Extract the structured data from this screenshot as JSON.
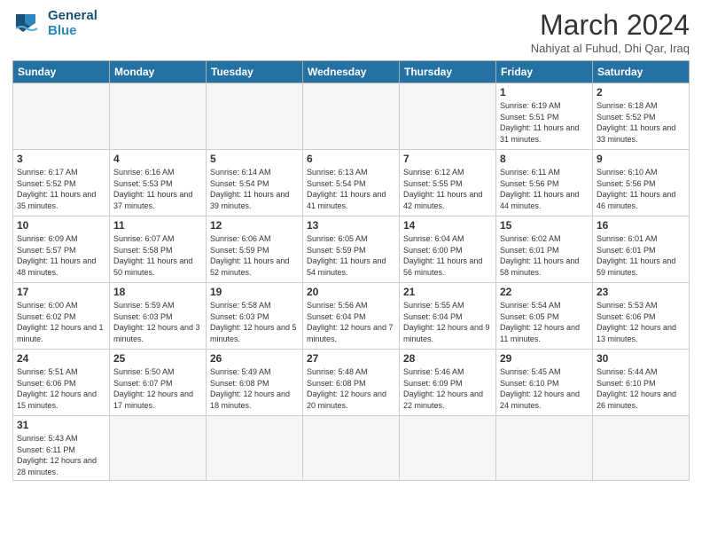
{
  "header": {
    "logo_general": "General",
    "logo_blue": "Blue",
    "month_title": "March 2024",
    "subtitle": "Nahiyat al Fuhud, Dhi Qar, Iraq"
  },
  "weekdays": [
    "Sunday",
    "Monday",
    "Tuesday",
    "Wednesday",
    "Thursday",
    "Friday",
    "Saturday"
  ],
  "weeks": [
    [
      {
        "day": "",
        "info": ""
      },
      {
        "day": "",
        "info": ""
      },
      {
        "day": "",
        "info": ""
      },
      {
        "day": "",
        "info": ""
      },
      {
        "day": "",
        "info": ""
      },
      {
        "day": "1",
        "info": "Sunrise: 6:19 AM\nSunset: 5:51 PM\nDaylight: 11 hours\nand 31 minutes."
      },
      {
        "day": "2",
        "info": "Sunrise: 6:18 AM\nSunset: 5:52 PM\nDaylight: 11 hours\nand 33 minutes."
      }
    ],
    [
      {
        "day": "3",
        "info": "Sunrise: 6:17 AM\nSunset: 5:52 PM\nDaylight: 11 hours\nand 35 minutes."
      },
      {
        "day": "4",
        "info": "Sunrise: 6:16 AM\nSunset: 5:53 PM\nDaylight: 11 hours\nand 37 minutes."
      },
      {
        "day": "5",
        "info": "Sunrise: 6:14 AM\nSunset: 5:54 PM\nDaylight: 11 hours\nand 39 minutes."
      },
      {
        "day": "6",
        "info": "Sunrise: 6:13 AM\nSunset: 5:54 PM\nDaylight: 11 hours\nand 41 minutes."
      },
      {
        "day": "7",
        "info": "Sunrise: 6:12 AM\nSunset: 5:55 PM\nDaylight: 11 hours\nand 42 minutes."
      },
      {
        "day": "8",
        "info": "Sunrise: 6:11 AM\nSunset: 5:56 PM\nDaylight: 11 hours\nand 44 minutes."
      },
      {
        "day": "9",
        "info": "Sunrise: 6:10 AM\nSunset: 5:56 PM\nDaylight: 11 hours\nand 46 minutes."
      }
    ],
    [
      {
        "day": "10",
        "info": "Sunrise: 6:09 AM\nSunset: 5:57 PM\nDaylight: 11 hours\nand 48 minutes."
      },
      {
        "day": "11",
        "info": "Sunrise: 6:07 AM\nSunset: 5:58 PM\nDaylight: 11 hours\nand 50 minutes."
      },
      {
        "day": "12",
        "info": "Sunrise: 6:06 AM\nSunset: 5:59 PM\nDaylight: 11 hours\nand 52 minutes."
      },
      {
        "day": "13",
        "info": "Sunrise: 6:05 AM\nSunset: 5:59 PM\nDaylight: 11 hours\nand 54 minutes."
      },
      {
        "day": "14",
        "info": "Sunrise: 6:04 AM\nSunset: 6:00 PM\nDaylight: 11 hours\nand 56 minutes."
      },
      {
        "day": "15",
        "info": "Sunrise: 6:02 AM\nSunset: 6:01 PM\nDaylight: 11 hours\nand 58 minutes."
      },
      {
        "day": "16",
        "info": "Sunrise: 6:01 AM\nSunset: 6:01 PM\nDaylight: 11 hours\nand 59 minutes."
      }
    ],
    [
      {
        "day": "17",
        "info": "Sunrise: 6:00 AM\nSunset: 6:02 PM\nDaylight: 12 hours\nand 1 minute."
      },
      {
        "day": "18",
        "info": "Sunrise: 5:59 AM\nSunset: 6:03 PM\nDaylight: 12 hours\nand 3 minutes."
      },
      {
        "day": "19",
        "info": "Sunrise: 5:58 AM\nSunset: 6:03 PM\nDaylight: 12 hours\nand 5 minutes."
      },
      {
        "day": "20",
        "info": "Sunrise: 5:56 AM\nSunset: 6:04 PM\nDaylight: 12 hours\nand 7 minutes."
      },
      {
        "day": "21",
        "info": "Sunrise: 5:55 AM\nSunset: 6:04 PM\nDaylight: 12 hours\nand 9 minutes."
      },
      {
        "day": "22",
        "info": "Sunrise: 5:54 AM\nSunset: 6:05 PM\nDaylight: 12 hours\nand 11 minutes."
      },
      {
        "day": "23",
        "info": "Sunrise: 5:53 AM\nSunset: 6:06 PM\nDaylight: 12 hours\nand 13 minutes."
      }
    ],
    [
      {
        "day": "24",
        "info": "Sunrise: 5:51 AM\nSunset: 6:06 PM\nDaylight: 12 hours\nand 15 minutes."
      },
      {
        "day": "25",
        "info": "Sunrise: 5:50 AM\nSunset: 6:07 PM\nDaylight: 12 hours\nand 17 minutes."
      },
      {
        "day": "26",
        "info": "Sunrise: 5:49 AM\nSunset: 6:08 PM\nDaylight: 12 hours\nand 18 minutes."
      },
      {
        "day": "27",
        "info": "Sunrise: 5:48 AM\nSunset: 6:08 PM\nDaylight: 12 hours\nand 20 minutes."
      },
      {
        "day": "28",
        "info": "Sunrise: 5:46 AM\nSunset: 6:09 PM\nDaylight: 12 hours\nand 22 minutes."
      },
      {
        "day": "29",
        "info": "Sunrise: 5:45 AM\nSunset: 6:10 PM\nDaylight: 12 hours\nand 24 minutes."
      },
      {
        "day": "30",
        "info": "Sunrise: 5:44 AM\nSunset: 6:10 PM\nDaylight: 12 hours\nand 26 minutes."
      }
    ],
    [
      {
        "day": "31",
        "info": "Sunrise: 5:43 AM\nSunset: 6:11 PM\nDaylight: 12 hours\nand 28 minutes."
      },
      {
        "day": "",
        "info": ""
      },
      {
        "day": "",
        "info": ""
      },
      {
        "day": "",
        "info": ""
      },
      {
        "day": "",
        "info": ""
      },
      {
        "day": "",
        "info": ""
      },
      {
        "day": "",
        "info": ""
      }
    ]
  ]
}
